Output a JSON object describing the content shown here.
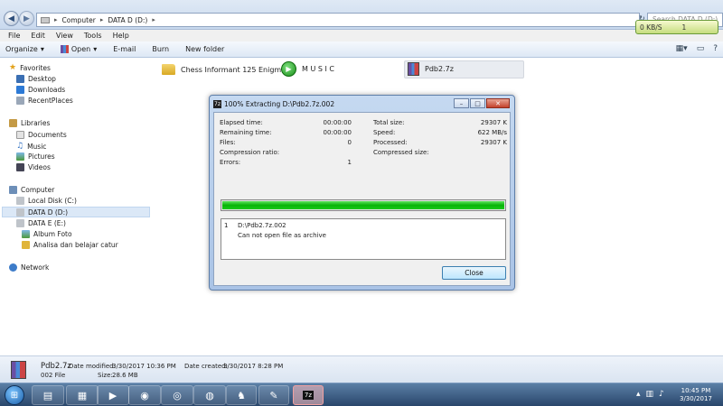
{
  "address": {
    "crumbs": [
      "Computer",
      "DATA D (D:)"
    ],
    "search_placeholder": "Search DATA D (D:)"
  },
  "speed_widget": {
    "speed": "0 KB/S",
    "count": "1"
  },
  "menu": [
    "File",
    "Edit",
    "View",
    "Tools",
    "Help"
  ],
  "toolbar": {
    "organize": "Organize",
    "open": "Open",
    "email": "E-mail",
    "burn": "Burn",
    "new_folder": "New folder"
  },
  "nav": {
    "favorites": "Favorites",
    "desktop": "Desktop",
    "downloads": "Downloads",
    "recent": "RecentPlaces",
    "libraries": "Libraries",
    "documents": "Documents",
    "music": "Music",
    "pictures": "Pictures",
    "videos": "Videos",
    "computer": "Computer",
    "local_c": "Local Disk (C:)",
    "data_d": "DATA D (D:)",
    "data_e": "DATA E (E:)",
    "album": "Album Foto",
    "analisa": "Analisa dan belajar catur",
    "network": "Network"
  },
  "files": {
    "chess": "Chess Informant 125 Enigma",
    "music": "M U S I C",
    "pdb": "Pdb2.7z"
  },
  "dialog": {
    "title": "100% Extracting D:\\Pdb2.7z.002",
    "elapsed_label": "Elapsed time:",
    "elapsed": "00:00:00",
    "remaining_label": "Remaining time:",
    "remaining": "00:00:00",
    "files_label": "Files:",
    "files": "0",
    "ratio_label": "Compression ratio:",
    "errors_label": "Errors:",
    "errors": "1",
    "total_label": "Total size:",
    "total": "29307 K",
    "speed_label": "Speed:",
    "speed": "622 MB/s",
    "processed_label": "Processed:",
    "processed": "29307 K",
    "compressed_label": "Compressed size:",
    "progress_percent": 100,
    "msg_index": "1",
    "msg_path": "D:\\Pdb2.7z.002",
    "msg_text": "Can not open file as archive",
    "close_label": "Close"
  },
  "details": {
    "name": "Pdb2.7z",
    "type": "002 File",
    "modified_label": "Date modified:",
    "modified": "3/30/2017 10:36 PM",
    "created_label": "Date created:",
    "created": "3/30/2017 8:28 PM",
    "size_label": "Size:",
    "size": "28.6 MB"
  },
  "taskbar": {
    "time": "10:45 PM",
    "date": "3/30/2017",
    "sevenzip": "7z"
  }
}
